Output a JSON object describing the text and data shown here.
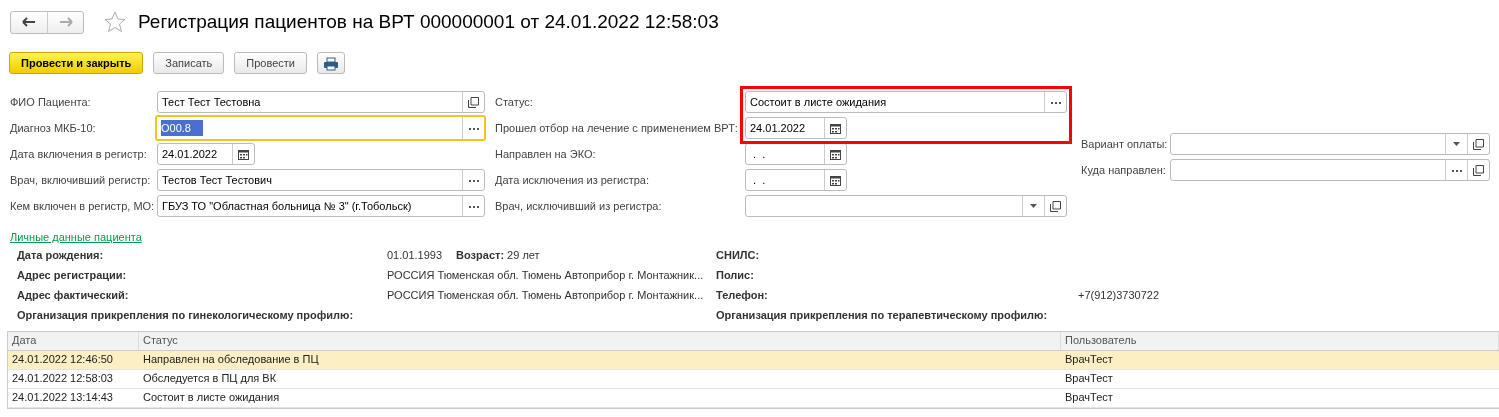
{
  "window": {
    "title": "Регистрация пациентов на ВРТ 000000001 от 24.01.2022 12:58:03",
    "favorite": false
  },
  "toolbar": [
    {
      "label": "Провести и закрыть",
      "kind": "default"
    },
    {
      "label": "Записать",
      "kind": "normal"
    },
    {
      "label": "Провести",
      "kind": "normal"
    },
    {
      "kind": "print"
    }
  ],
  "form": {
    "left": [
      {
        "label": "ФИО Пациента:",
        "value": "Тест Тест Тестовна",
        "kind": "open",
        "focused": false
      },
      {
        "label": "Диагноз МКБ-10:",
        "value": "O00.8",
        "kind": "select",
        "focused": true
      },
      {
        "label": "Дата включения в регистр:",
        "value": "24.01.2022",
        "kind": "date",
        "focused": false
      },
      {
        "label": "Врач, включивший регистр:",
        "value": "Тестов Тест Тестович",
        "kind": "select",
        "focused": false
      },
      {
        "label": "Кем включен в регистр, МО:",
        "value": "ГБУЗ ТО \"Областная больница № 3\" (г.Тобольск)",
        "kind": "select",
        "focused": false
      }
    ],
    "middle": [
      {
        "label": "Статус:",
        "value": "Состоит в листе ожидания",
        "kind": "select",
        "highlighted": true
      },
      {
        "label": "Прошел отбор на лечение с применением ВРТ:",
        "value": "24.01.2022",
        "kind": "date",
        "highlighted": true
      },
      {
        "label": "Направлен на ЭКО:",
        "value": " .  .",
        "kind": "date",
        "highlighted": false
      },
      {
        "label": "Дата исключения из регистра:",
        "value": " .  .",
        "kind": "date",
        "highlighted": false
      },
      {
        "label": "Врач, исключивший из регистра:",
        "kind": "dropdown",
        "highlighted": false
      }
    ],
    "right": [
      {
        "label": "Вариант оплаты:",
        "kind": "dropdown"
      },
      {
        "label": "Куда направлен:",
        "kind": "select_open"
      }
    ]
  },
  "personal": {
    "link": "Личные данные пациента",
    "rows": [
      {
        "label": "Дата рождения:",
        "value": "01.01.1993",
        "age": "**Возраст:** 29 лет",
        "right_label": "СНИЛС:"
      },
      {
        "label": "Адрес регистрации:",
        "value": "РОССИЯ Тюменская обл. Тюмень Автоприбор г. Монтажник...",
        "right_label": "Полис:"
      },
      {
        "label": "Адрес фактический:",
        "value": "РОССИЯ Тюменская обл. Тюмень Автоприбор г. Монтажник...",
        "right_label": "Телефон:",
        "right_value": "+7(912)3730722"
      },
      {
        "label": "Организация прикрепления по гинекологическому профилю:",
        "right_label": "Организация прикрепления по терапевтическому профилю:"
      }
    ]
  },
  "table": {
    "columns": [
      "Дата",
      "Статус",
      "Пользователь"
    ],
    "rows": [
      {
        "cells": [
          "24.01.2022 12:46:50",
          "Направлен на обследование в ПЦ",
          "ВрачТест"
        ],
        "selected": true
      },
      {
        "cells": [
          "24.01.2022 12:58:03",
          "Обследуется в ПЦ для ВК",
          "ВрачТест"
        ],
        "selected": false
      },
      {
        "cells": [
          "24.01.2022 13:14:43",
          "Состоит в листе ожидания",
          "ВрачТест"
        ],
        "selected": false
      }
    ]
  }
}
